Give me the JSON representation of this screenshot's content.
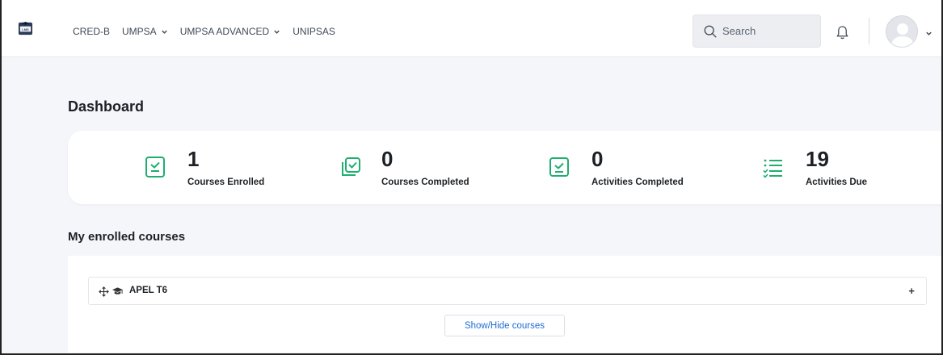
{
  "nav": {
    "links": [
      {
        "label": "CRED-B",
        "dropdown": false
      },
      {
        "label": "UMPSA",
        "dropdown": true
      },
      {
        "label": "UMPSA ADVANCED",
        "dropdown": true
      },
      {
        "label": "UNIPSAS",
        "dropdown": false
      }
    ],
    "search_placeholder": "Search",
    "icons": {
      "logo": "lms-logo-icon",
      "search": "search-icon",
      "notifications": "bell-icon",
      "avatar": "user-avatar"
    }
  },
  "page": {
    "title": "Dashboard"
  },
  "stats": [
    {
      "value": "1",
      "label": "Courses Enrolled",
      "icon": "clipboard-check-icon"
    },
    {
      "value": "0",
      "label": "Courses Completed",
      "icon": "stacked-check-icon"
    },
    {
      "value": "0",
      "label": "Activities Completed",
      "icon": "checkbox-icon"
    },
    {
      "value": "19",
      "label": "Activities Due",
      "icon": "checklist-icon"
    }
  ],
  "courses_section": {
    "title": "My enrolled courses",
    "courses": [
      {
        "name": "APEL T6",
        "expand": "+"
      }
    ],
    "toggle_label": "Show/Hide courses"
  },
  "colors": {
    "accent_green": "#1fae6f",
    "link_blue": "#1f6bd6",
    "background": "#f5f6fa"
  }
}
